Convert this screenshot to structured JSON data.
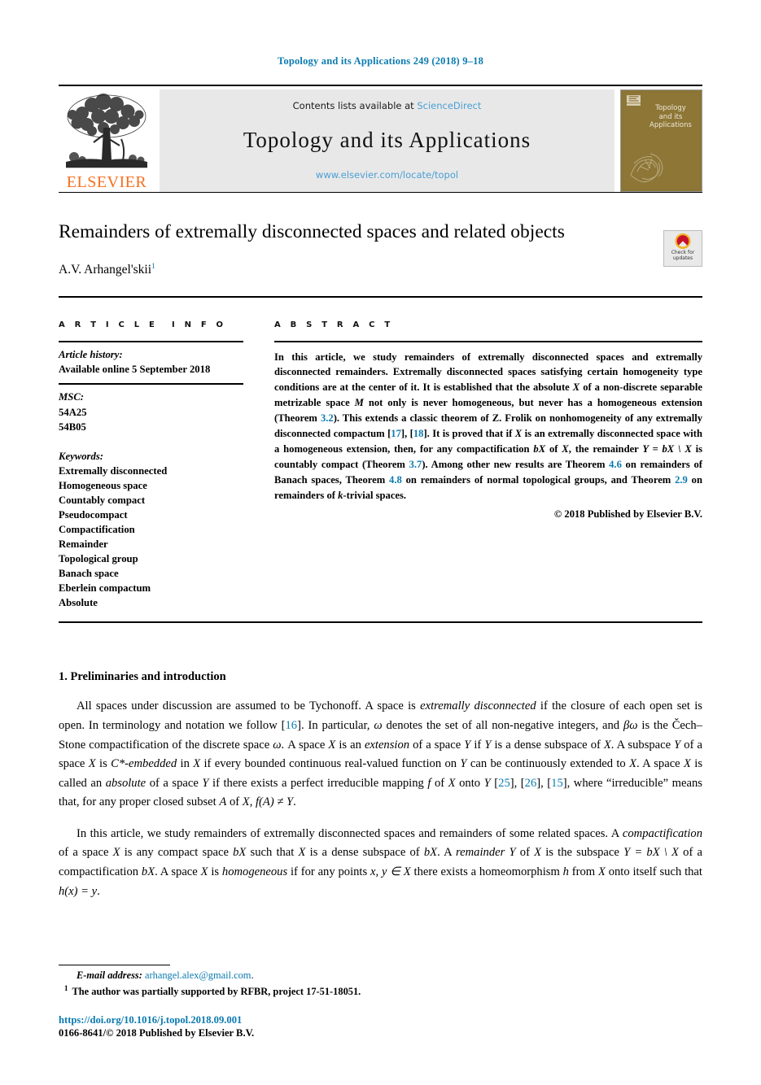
{
  "running_head": "Topology and its Applications 249 (2018) 9–18",
  "masthead": {
    "publisher_name": "ELSEVIER",
    "contents_prefix": "Contents lists available at ",
    "contents_link": "ScienceDirect",
    "journal_title": "Topology and its Applications",
    "journal_url": "www.elsevier.com/locate/topol",
    "cover_title_line1": "Topology",
    "cover_title_line2": "and its",
    "cover_title_line3": "Applications"
  },
  "title_block": {
    "article_title": "Remainders of extremally disconnected spaces and related objects",
    "author": "A.V. Arhangel'skii",
    "author_footnote_marker": "1",
    "crossmark_line1": "Check for",
    "crossmark_line2": "updates"
  },
  "article_info": {
    "heading_word1": "A R T I C L E",
    "heading_word2": "I N F O",
    "history_label": "Article history:",
    "history_value": "Available online 5 September 2018",
    "msc_label": "MSC:",
    "msc_codes": [
      "54A25",
      "54B05"
    ],
    "keywords_label": "Keywords:",
    "keywords": [
      "Extremally disconnected",
      "Homogeneous space",
      "Countably compact",
      "Pseudocompact",
      "Compactification",
      "Remainder",
      "Topological group",
      "Banach space",
      "Eberlein compactum",
      "Absolute"
    ]
  },
  "abstract": {
    "heading": "A B S T R A C T",
    "p1_a": "In this article, we study remainders of extremally disconnected spaces and extremally disconnected remainders. Extremally disconnected spaces satisfying certain homogeneity type conditions are at the center of it. It is established that the absolute ",
    "x1": "X",
    "p1_b": " of a non-discrete separable metrizable space ",
    "m1": "M",
    "p1_c": " not only is never homogeneous, but never has a homogeneous extension (Theorem ",
    "ref32": "3.2",
    "p1_d": "). This extends a classic theorem of Z. Frolik on nonhomogeneity of any extremally disconnected compactum [",
    "ref17": "17",
    "p1_e": "], [",
    "ref18": "18",
    "p1_f": "]. It is proved that if ",
    "x2": "X",
    "p1_g": " is an extremally disconnected space with a homogeneous extension, then, for any compactification ",
    "bx1": "bX",
    "p1_h": " of ",
    "x3": "X",
    "p1_i": ", the remainder ",
    "eq1": "Y = bX \\ X",
    "p1_j": " is countably compact (Theorem ",
    "ref37": "3.7",
    "p1_k": "). Among other new results are Theorem ",
    "ref46": "4.6",
    "p1_l": " on remainders of Banach spaces, Theorem ",
    "ref48": "4.8",
    "p1_m": " on remainders of normal topological groups, and Theorem ",
    "ref29": "2.9",
    "p1_n": " on remainders of ",
    "k1": "k",
    "p1_o": "-trivial spaces.",
    "copyright": "© 2018 Published by Elsevier B.V."
  },
  "section1": {
    "heading": "1. Preliminaries and introduction",
    "p1_a": "All spaces under discussion are assumed to be Tychonoff. A space is ",
    "p1_i1": "extremally disconnected",
    "p1_b": " if the closure of each open set is open. In terminology and notation we follow [",
    "ref16": "16",
    "p1_c": "]. In particular, ",
    "omega1": "ω",
    "p1_d": " denotes the set of all non-negative integers, and ",
    "betaomega": "βω",
    "p1_e": " is the Čech–Stone compactification of the discrete space ",
    "omega2": "ω",
    "p1_f": ". A space ",
    "x1": "X",
    "p1_g": " is an ",
    "p1_i2": "extension",
    "p1_h": " of a space ",
    "y1": "Y",
    "p1_j": " if ",
    "y2": "Y",
    "p1_k": " is a dense subspace of ",
    "x2": "X",
    "p1_l": ". A subspace ",
    "y3": "Y",
    "p1_m": " of a space ",
    "x3": "X",
    "p1_n": " is ",
    "p1_i3": "C*-embedded",
    "p1_o": " in ",
    "x4": "X",
    "p1_p": " if every bounded continuous real-valued function on ",
    "y4": "Y",
    "p1_q": " can be continuously extended to ",
    "x5": "X",
    "p1_r": ". A space ",
    "x6": "X",
    "p1_s": " is called an ",
    "p1_i4": "absolute",
    "p1_t": " of a space ",
    "y5": "Y",
    "p1_u": " if there exists a perfect irreducible mapping ",
    "f1": "f",
    "p1_v": " of ",
    "x7": "X",
    "p1_w": " onto ",
    "y6": "Y",
    "p1_x": " [",
    "ref25": "25",
    "p1_y": "], [",
    "ref26": "26",
    "p1_z": "], [",
    "ref15": "15",
    "p1_aa": "], where “irreducible” means that, for any proper closed subset ",
    "a1": "A",
    "p1_ab": " of ",
    "x8": "X",
    "p1_ac": ", ",
    "eq_fa": "f(A) ≠ Y",
    "p1_ad": ".",
    "p2_a": "In this article, we study remainders of extremally disconnected spaces and remainders of some related spaces. A ",
    "p2_i1": "compactification",
    "p2_b": " of a space ",
    "x9": "X",
    "p2_c": " is any compact space ",
    "bx1": "bX",
    "p2_d": " such that ",
    "x10": "X",
    "p2_e": " is a dense subspace of ",
    "bx2": "bX",
    "p2_f": ". A ",
    "p2_i2": "remainder",
    "p2_g": " ",
    "y7": "Y",
    "p2_h": " of ",
    "x11": "X",
    "p2_i": " is the subspace ",
    "eq2": "Y = bX \\ X",
    "p2_j": " of a compactification ",
    "bx3": "bX",
    "p2_k": ". A space ",
    "x12": "X",
    "p2_l": " is ",
    "p2_i3": "homogeneous",
    "p2_m": " if for any points ",
    "eq3": "x, y ∈ X",
    "p2_n": " there exists a homeomorphism ",
    "h1": "h",
    "p2_o": " from ",
    "x13": "X",
    "p2_p": " onto itself such that ",
    "eq4": "h(x) = y",
    "p2_q": "."
  },
  "footnotes": {
    "email_label": "E-mail address:",
    "email": "arhangel.alex@gmail.com",
    "email_suffix": ".",
    "note_marker": "1",
    "note_text": "The author was partially supported by RFBR, project 17-51-18051.",
    "doi": "https://doi.org/10.1016/j.topol.2018.09.001",
    "issn_line": "0166-8641/© 2018 Published by Elsevier B.V."
  },
  "colors": {
    "link_blue": "#0b7ab0",
    "sciencedirect_blue": "#4a9fd4",
    "elsevier_orange": "#f37021",
    "cover_brown": "#8d7636",
    "masthead_gray": "#e8e8e8"
  }
}
